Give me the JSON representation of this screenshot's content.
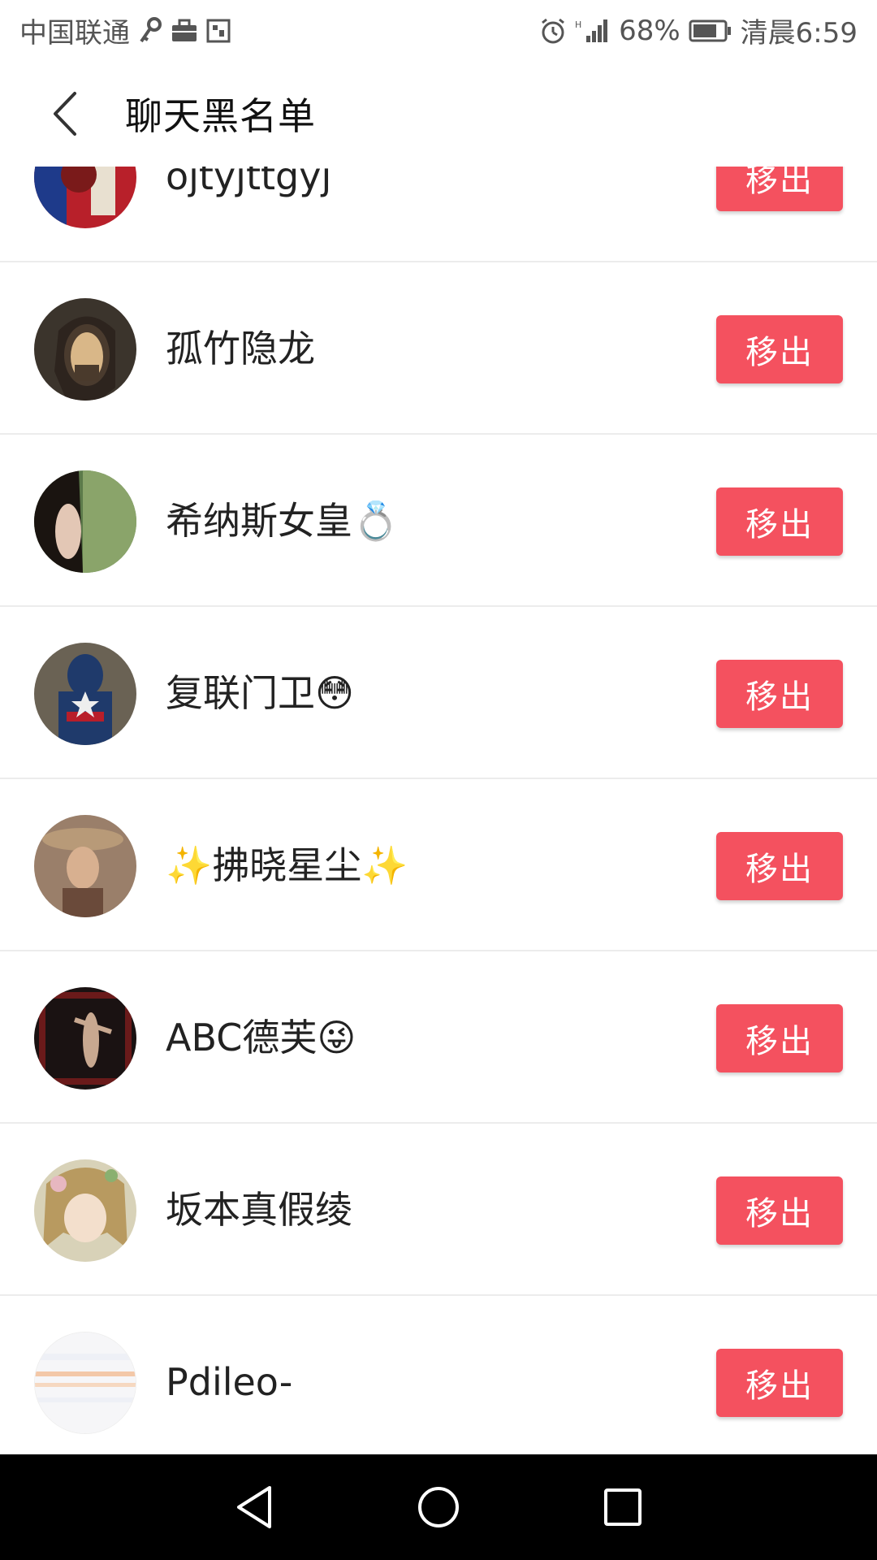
{
  "status_bar": {
    "carrier": "中国联通",
    "battery": "68%",
    "time": "清晨6:59",
    "icons": [
      "key-icon",
      "briefcase-icon",
      "app-icon",
      "alarm-icon",
      "signal-icon",
      "battery-icon"
    ]
  },
  "header": {
    "title": "聊天黑名单",
    "back_icon": "chevron-left-icon"
  },
  "blacklist": {
    "remove_label": "移出",
    "items": [
      {
        "name": "ojtyjttgyj",
        "avatar": "avatar-red-figure"
      },
      {
        "name": "孤竹隐龙",
        "avatar": "avatar-warrior"
      },
      {
        "name": "希纳斯女皇💍",
        "avatar": "avatar-woman-green"
      },
      {
        "name": "复联门卫😳",
        "avatar": "avatar-captain-america"
      },
      {
        "name": "✨拂晓星尘✨",
        "avatar": "avatar-cowgirl"
      },
      {
        "name": "ABC德芙😜",
        "avatar": "avatar-dancer"
      },
      {
        "name": "坂本真假绫",
        "avatar": "avatar-anime-girl"
      },
      {
        "name": "Pdileo-",
        "avatar": "avatar-document"
      }
    ]
  },
  "nav_bar": {
    "icons": [
      "back-triangle-icon",
      "home-circle-icon",
      "recents-square-icon"
    ]
  },
  "colors": {
    "accent": "#f4515f",
    "divider": "#ececec",
    "nav_background": "#000000"
  }
}
